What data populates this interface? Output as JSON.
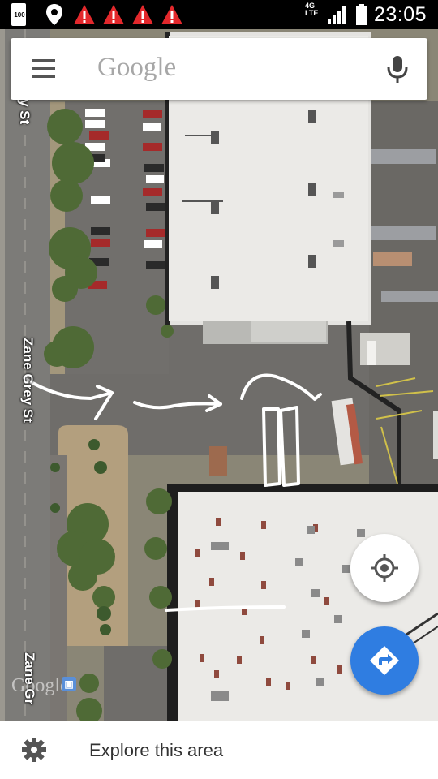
{
  "status_bar": {
    "battery_level": "100",
    "network_type_top": "4G",
    "network_type_bottom": "LTE",
    "time": "23:05",
    "warning_icons": [
      "warning-icon",
      "warning-icon",
      "warning-icon",
      "warning-icon"
    ]
  },
  "search": {
    "placeholder": "Google",
    "menu_icon": "hamburger-menu-icon",
    "mic_icon": "microphone-icon"
  },
  "map": {
    "street_labels": [
      "y St",
      "Zane Grey St",
      "Zane Gr"
    ],
    "watermark": "Google"
  },
  "buttons": {
    "my_location_icon": "my-location-icon",
    "directions_icon": "directions-icon",
    "directions_color": "#2f7de1"
  },
  "bottom_panel": {
    "icon": "gear-icon",
    "label": "Explore this area"
  }
}
